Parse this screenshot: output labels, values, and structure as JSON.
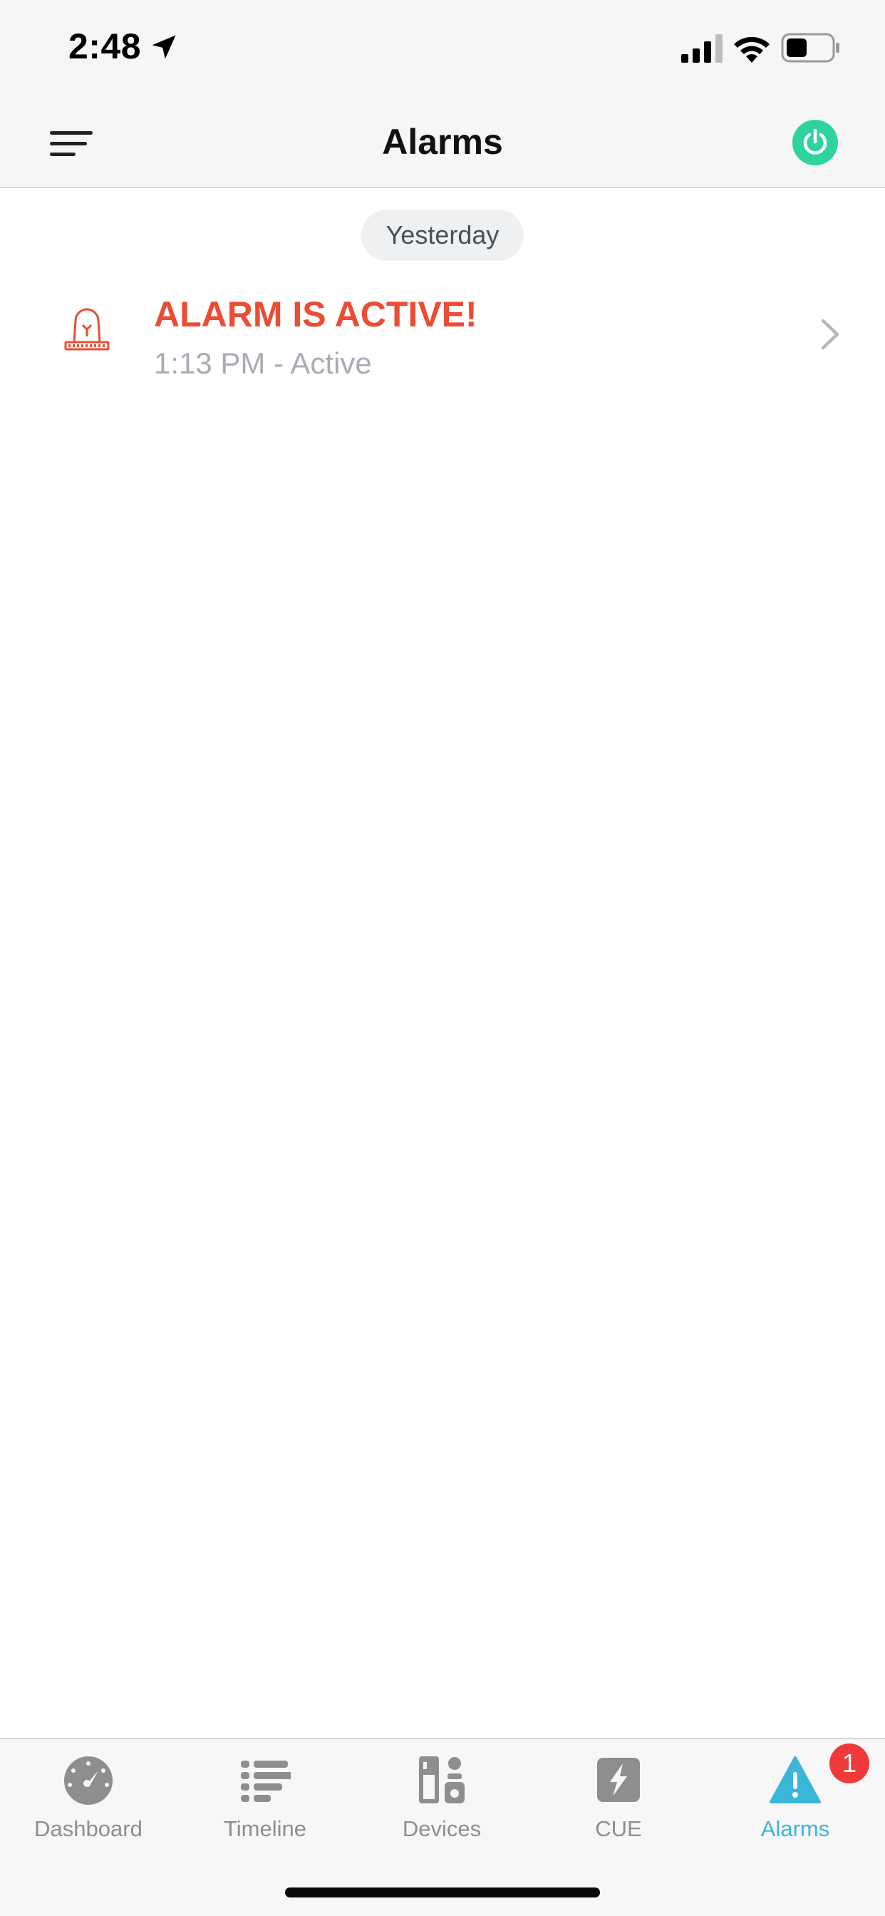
{
  "status_bar": {
    "time": "2:48",
    "icons": [
      "location-arrow-icon",
      "cellular-signal-icon",
      "wifi-icon",
      "battery-icon"
    ]
  },
  "nav": {
    "title": "Alarms",
    "menu_icon": "hamburger-menu-icon",
    "power_icon": "power-icon",
    "power_color": "#2fd3a0"
  },
  "alarms": {
    "section_label": "Yesterday",
    "items": [
      {
        "title": "ALARM IS ACTIVE!",
        "subtitle": "1:13 PM - Active",
        "icon": "siren-icon",
        "title_color": "#ea4d34"
      }
    ]
  },
  "tabs": [
    {
      "label": "Dashboard",
      "icon": "dashboard-gauge-icon",
      "active": false
    },
    {
      "label": "Timeline",
      "icon": "timeline-list-icon",
      "active": false
    },
    {
      "label": "Devices",
      "icon": "devices-icon",
      "active": false
    },
    {
      "label": "CUE",
      "icon": "cue-bolt-icon",
      "active": false
    },
    {
      "label": "Alarms",
      "icon": "alarm-warning-icon",
      "active": true,
      "badge": "1"
    }
  ],
  "colors": {
    "accent_active_tab": "#3bb6d8",
    "inactive_tab": "#8e8e8e",
    "badge": "#f03a3a"
  }
}
